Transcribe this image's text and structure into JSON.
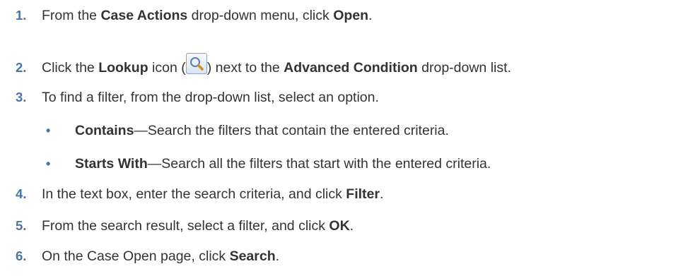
{
  "steps": [
    {
      "num": "1.",
      "parts": [
        "From the ",
        "Case Actions",
        " drop-down menu, click ",
        "Open",
        "."
      ]
    },
    {
      "num": "2.",
      "parts": [
        "Click the ",
        "Lookup",
        " icon (",
        ") next to the ",
        "Advanced Condition",
        " drop-down list."
      ]
    },
    {
      "num": "3.",
      "parts": [
        "To find a filter, from the drop-down list, select an option."
      ]
    },
    {
      "num": "4.",
      "parts": [
        "In the text box, enter the search criteria, and click ",
        "Filter",
        "."
      ]
    },
    {
      "num": "5.",
      "parts": [
        "From the search result, select a filter, and click ",
        "OK",
        "."
      ]
    },
    {
      "num": "6.",
      "parts": [
        "On the Case Open page, click ",
        "Search",
        "."
      ]
    }
  ],
  "options": [
    {
      "bullet": "•",
      "term": "Contains",
      "desc": "—Search the filters that contain the entered criteria."
    },
    {
      "bullet": "•",
      "term": "Starts With",
      "desc": "—Search all the filters that start with the entered criteria."
    }
  ],
  "icons": {
    "lookup": "magnifier-icon"
  },
  "colors": {
    "number": "#4a74a5",
    "text": "#333333"
  }
}
